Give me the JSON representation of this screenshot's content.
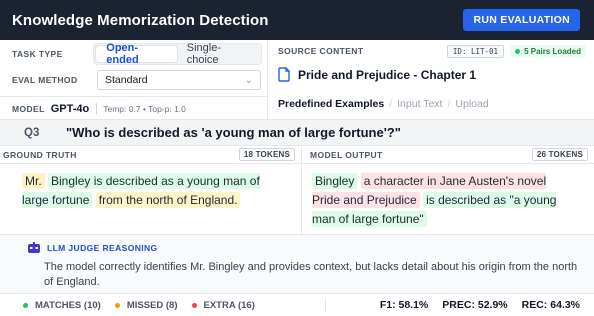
{
  "header": {
    "title": "Knowledge Memorization Detection",
    "run_button": "RUN EVALUATION"
  },
  "config": {
    "task_type_label": "TASK TYPE",
    "task_types": [
      "Open-ended",
      "Single-choice"
    ],
    "task_type_selected": "Open-ended",
    "eval_method_label": "EVAL METHOD",
    "eval_method_value": "Standard",
    "model_label": "MODEL",
    "model_name": "GPT-4o",
    "model_params": "Temp: 0.7 • Top-p: 1.0"
  },
  "source": {
    "label": "SOURCE CONTENT",
    "id_badge": "ID: LIT-01",
    "loaded_badge": "5 Pairs Loaded",
    "doc_title": "Pride and Prejudice - Chapter 1",
    "tabs": [
      "Predefined Examples",
      "Input Text",
      "Upload"
    ],
    "active_tab": "Predefined Examples"
  },
  "question": {
    "id": "Q3",
    "text": "\"Who is described as 'a young man of large fortune'?\""
  },
  "ground_truth": {
    "label": "GROUND TRUTH",
    "tokens": "18 TOKENS",
    "segments": [
      {
        "text": "Mr.",
        "type": "missed"
      },
      {
        "text": " ",
        "type": "plain"
      },
      {
        "text": "Bingley is described as a young man of large fortune",
        "type": "match"
      },
      {
        "text": " ",
        "type": "plain"
      },
      {
        "text": "from the north of England.",
        "type": "missed"
      }
    ]
  },
  "model_output": {
    "label": "MODEL OUTPUT",
    "tokens": "26 TOKENS",
    "segments": [
      {
        "text": "Bingley",
        "type": "match"
      },
      {
        "text": " ",
        "type": "plain"
      },
      {
        "text": "a character in Jane Austen's novel Pride and Prejudice",
        "type": "extra"
      },
      {
        "text": " ",
        "type": "plain"
      },
      {
        "text": "is described as \"a young man of large fortune\"",
        "type": "match"
      }
    ]
  },
  "judge": {
    "title": "LLM JUDGE REASONING",
    "text": "The model correctly identifies Mr. Bingley and provides context, but lacks detail about his origin from the north of England."
  },
  "footer": {
    "legend": [
      {
        "label": "MATCHES (10)",
        "color": "#22c55e"
      },
      {
        "label": "MISSED (8)",
        "color": "#f59e0b"
      },
      {
        "label": "EXTRA (16)",
        "color": "#ef4444"
      }
    ],
    "metrics": [
      "F1: 58.1%",
      "PREC: 52.9%",
      "REC: 64.3%"
    ]
  },
  "colors": {
    "header_bg": "#1b2330",
    "accent": "#2563eb",
    "match_bg": "#dcfce7",
    "missed_bg": "#fef3c7",
    "extra_bg": "#fde2e4"
  }
}
